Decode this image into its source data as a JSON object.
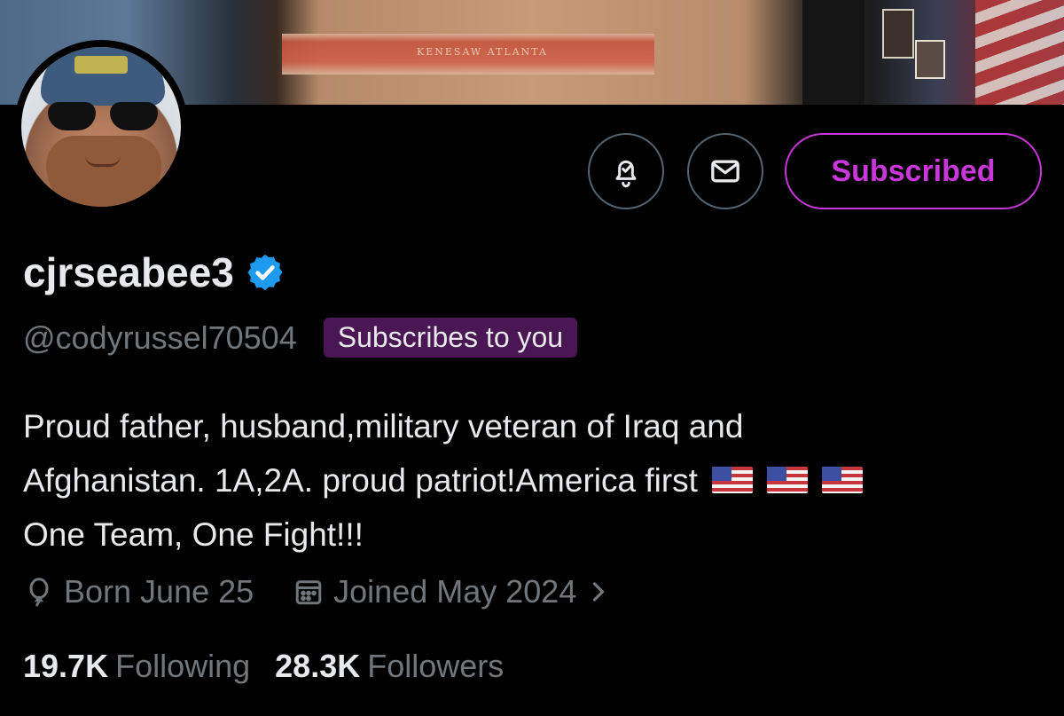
{
  "profile": {
    "display_name": "cjrseabee3",
    "handle": "@codyrussel70504",
    "subscribes_badge": "Subscribes to you",
    "bio_line1": "Proud father, husband,military veteran of Iraq and",
    "bio_line2": "Afghanistan. 1A,2A. proud patriot!America first",
    "bio_line3": "One Team, One Fight!!!",
    "bio_flags": [
      "us-flag-icon",
      "us-flag-icon",
      "us-flag-icon"
    ],
    "birthday": "Born June 25",
    "joined": "Joined May 2024",
    "following_count": "19.7K",
    "following_label": "Following",
    "followers_count": "28.3K",
    "followers_label": "Followers"
  },
  "actions": {
    "notify_icon": "bell-check-icon",
    "message_icon": "envelope-icon",
    "subscribed_label": "Subscribed"
  },
  "banner": {
    "flag_text": "KENESAW ATLANTA"
  },
  "colors": {
    "background": "#000000",
    "accent_purple": "#c936d9",
    "badge_bg": "#4a1654",
    "verified_blue": "#1d9bf0",
    "secondary_text": "#71767b"
  }
}
